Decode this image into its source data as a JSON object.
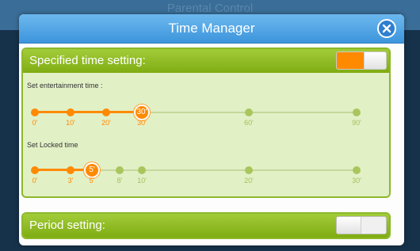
{
  "background": {
    "title": "Parental Control"
  },
  "dialog": {
    "title": "Time Manager",
    "close_icon": "close-icon"
  },
  "specified": {
    "title": "Specified time setting:",
    "toggle_on": true,
    "entertainment": {
      "label": "Set entertainment time :",
      "selected": "30'",
      "ticks": [
        "0'",
        "10'",
        "20'",
        "30'",
        "60'",
        "90'"
      ]
    },
    "locked": {
      "label": "Set Locked time",
      "selected": "5'",
      "ticks": [
        "0'",
        "3'",
        "5'",
        "8'",
        "10'",
        "20'",
        "30'"
      ]
    }
  },
  "period": {
    "title": "Period setting:",
    "toggle_on": false
  },
  "colors": {
    "accent": "#ff8a00",
    "section_green": "#8cb82a",
    "header_blue": "#3d95dc"
  }
}
